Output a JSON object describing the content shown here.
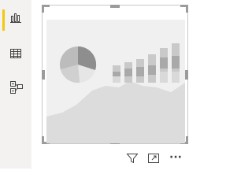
{
  "nav": {
    "items": [
      {
        "id": "report",
        "icon": "report-chart-icon",
        "active": true
      },
      {
        "id": "data",
        "icon": "table-grid-icon",
        "active": false
      },
      {
        "id": "model",
        "icon": "model-diagram-icon",
        "active": false
      }
    ],
    "accent_color": "#f2c811"
  },
  "visual": {
    "placeholder_graphic": "empty-visual-placeholder",
    "colors": {
      "border": "#c8c8c8",
      "handles": "#9b9b9b",
      "placeholder_bg": "#f0f0f0"
    }
  },
  "toolbar": {
    "filter_icon": "filter-icon",
    "focus_icon": "focus-mode-icon",
    "more_label": "···"
  }
}
